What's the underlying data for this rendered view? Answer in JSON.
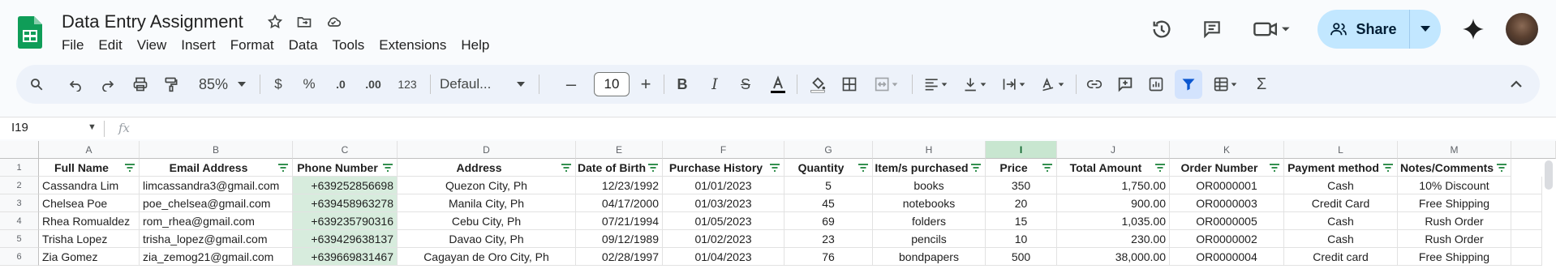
{
  "app": {
    "title": "Data Entry Assignment",
    "menu": [
      "File",
      "Edit",
      "View",
      "Insert",
      "Format",
      "Data",
      "Tools",
      "Extensions",
      "Help"
    ],
    "share_label": "Share"
  },
  "toolbar": {
    "zoom": "85%",
    "currency": "$",
    "percent": "%",
    "dec_decrease": ".0",
    "dec_increase": ".00",
    "number_format": "123",
    "font": "Defaul...",
    "font_size": "10",
    "icons": [
      "search-icon",
      "undo-icon",
      "redo-icon",
      "print-icon",
      "paint-format-icon",
      "bold-icon",
      "italic-icon",
      "strikethrough-icon",
      "text-color-icon",
      "fill-color-icon",
      "borders-icon",
      "merge-icon",
      "align-icon",
      "valign-icon",
      "wrap-icon",
      "rotate-icon",
      "link-icon",
      "comment-icon",
      "chart-icon",
      "filter-icon",
      "table-icon",
      "functions-icon"
    ]
  },
  "formula_bar": {
    "cell_ref": "I19",
    "fx": "fx",
    "value": ""
  },
  "sheet": {
    "selected_column": "I",
    "columns": [
      "A",
      "B",
      "C",
      "D",
      "E",
      "F",
      "G",
      "H",
      "I",
      "J",
      "K",
      "L",
      "M"
    ],
    "rows": [
      "1",
      "2",
      "3",
      "4",
      "5",
      "6"
    ],
    "headers": [
      "Full Name",
      "Email Address",
      "Phone Number",
      "Address",
      "Date of Birth",
      "Purchase History",
      "Quantity",
      "Item/s purchased",
      "Price",
      "Total Amount",
      "Order Number",
      "Payment method",
      "Notes/Comments"
    ],
    "data": [
      [
        "Cassandra Lim",
        "limcassandra3@gmail.com",
        "+639252856698",
        "Quezon City, Ph",
        "12/23/1992",
        "01/01/2023",
        "5",
        "books",
        "350",
        "1,750.00",
        "OR0000001",
        "Cash",
        "10% Discount"
      ],
      [
        "Chelsea Poe",
        "poe_chelsea@gmail.com",
        "+639458963278",
        "Manila City, Ph",
        "04/17/2000",
        "01/03/2023",
        "45",
        "notebooks",
        "20",
        "900.00",
        "OR0000003",
        "Credit Card",
        "Free Shipping"
      ],
      [
        "Rhea Romualdez",
        "rom_rhea@gmail.com",
        "+639235790316",
        "Cebu City, Ph",
        "07/21/1994",
        "01/05/2023",
        "69",
        "folders",
        "15",
        "1,035.00",
        "OR0000005",
        "Cash",
        "Rush Order"
      ],
      [
        "Trisha Lopez",
        "trisha_lopez@gmail.com",
        "+639429638137",
        "Davao City, Ph",
        "09/12/1989",
        "01/02/2023",
        "23",
        "pencils",
        "10",
        "230.00",
        "OR0000002",
        "Cash",
        "Rush Order"
      ],
      [
        "Zia Gomez",
        "zia_zemog21@gmail.com",
        "+639669831467",
        "Cagayan de Oro City, Ph",
        "02/28/1997",
        "01/04/2023",
        "76",
        "bondpapers",
        "500",
        "38,000.00",
        "OR0000004",
        "Credit card",
        "Free Shipping"
      ]
    ]
  },
  "colors": {
    "accent": "#c2e7ff",
    "selected_col": "#c8e6d0",
    "phone_fill": "#d7ecdd",
    "sheets_green": "#0f9d58"
  }
}
